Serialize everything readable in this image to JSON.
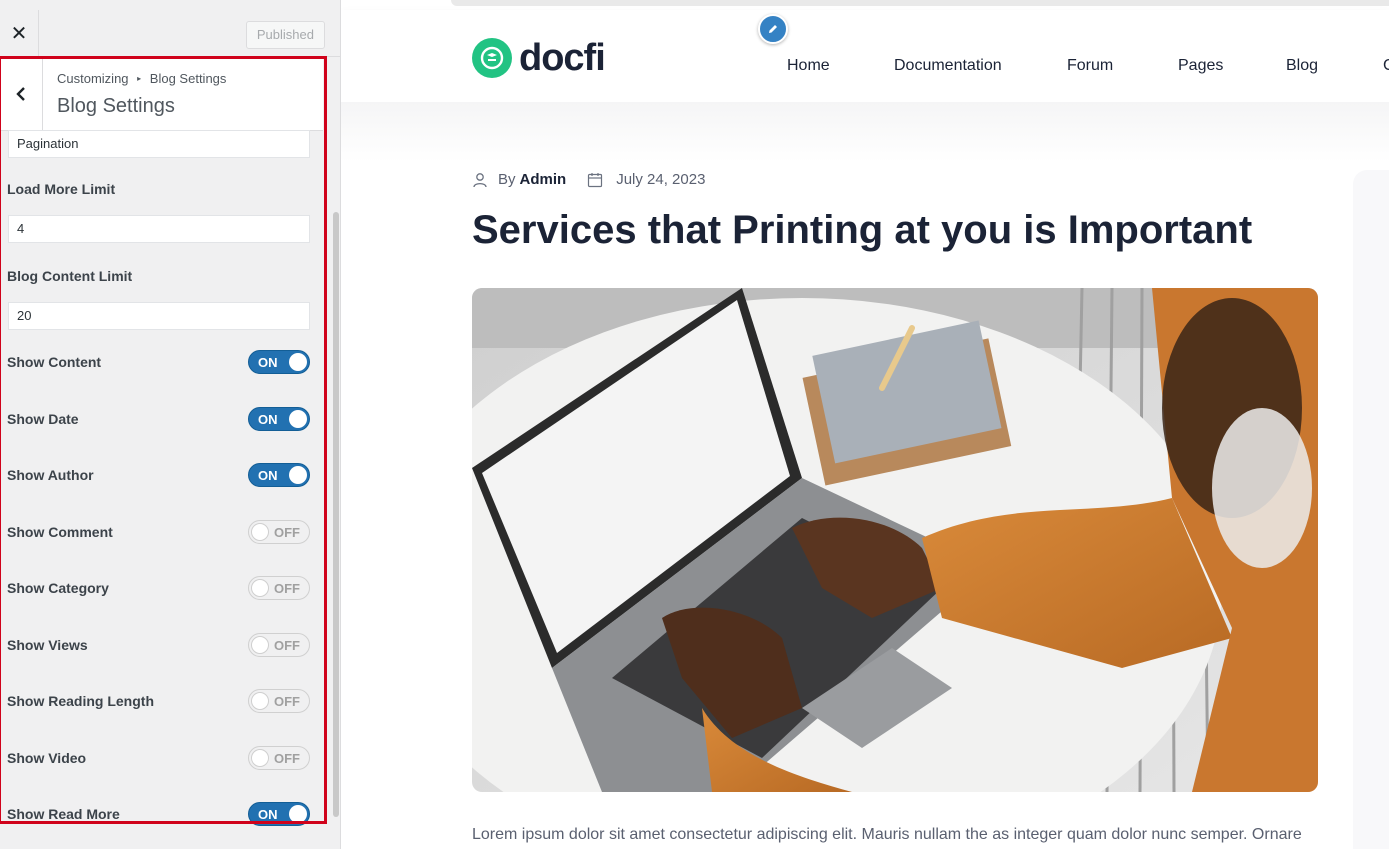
{
  "customizer": {
    "close_label": "✕",
    "publish_label": "Published",
    "breadcrumb": {
      "parent": "Customizing",
      "separator": "▸",
      "current": "Blog Settings"
    },
    "section_title": "Blog Settings",
    "pagination_value": "Pagination",
    "load_more": {
      "label": "Load More Limit",
      "value": "4"
    },
    "content_limit": {
      "label": "Blog Content Limit",
      "value": "20"
    },
    "toggles": [
      {
        "label": "Show Content",
        "state": "ON"
      },
      {
        "label": "Show Date",
        "state": "ON"
      },
      {
        "label": "Show Author",
        "state": "ON"
      },
      {
        "label": "Show Comment",
        "state": "OFF"
      },
      {
        "label": "Show Category",
        "state": "OFF"
      },
      {
        "label": "Show Views",
        "state": "OFF"
      },
      {
        "label": "Show Reading Length",
        "state": "OFF"
      },
      {
        "label": "Show Video",
        "state": "OFF"
      },
      {
        "label": "Show Read More",
        "state": "ON"
      }
    ],
    "highlight_color": "#d0021b",
    "toggle_on_color": "#2271b1"
  },
  "site": {
    "logo_text": "docfi",
    "brand_color": "#22c383",
    "nav": [
      "Home",
      "Documentation",
      "Forum",
      "Pages",
      "Blog",
      "C"
    ],
    "post": {
      "by_label": "By",
      "author": "Admin",
      "date": "July 24, 2023",
      "title": "Services that Printing at you is Important",
      "excerpt": "Lorem ipsum dolor sit amet consectetur adipiscing elit. Mauris nullam the as integer quam dolor nunc semper. Ornare"
    }
  }
}
